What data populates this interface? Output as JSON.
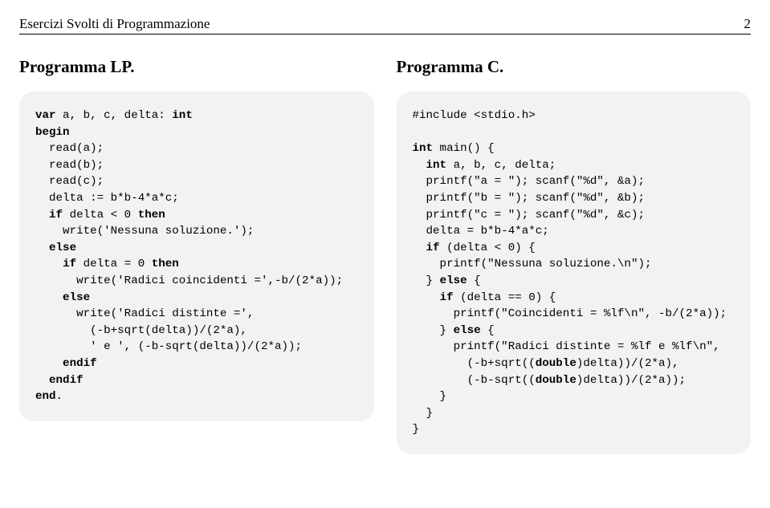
{
  "header": {
    "title": "Esercizi Svolti di Programmazione",
    "page": "2"
  },
  "left": {
    "heading": "Programma LP.",
    "l1a": "var",
    "l1b": " a, b, c, delta: ",
    "l1c": "int",
    "l2": "begin",
    "l3": "  read(a);",
    "l4": "  read(b);",
    "l5": "  read(c);",
    "l6": "  delta := b*b-4*a*c;",
    "l7a": "  ",
    "l7b": "if",
    "l7c": " delta < 0 ",
    "l7d": "then",
    "l8": "    write('Nessuna soluzione.');",
    "l9": "  else",
    "l10a": "    ",
    "l10b": "if",
    "l10c": " delta = 0 ",
    "l10d": "then",
    "l11": "      write('Radici coincidenti =',-b/(2*a));",
    "l12": "    else",
    "l13": "      write('Radici distinte =',",
    "l14": "        (-b+sqrt(delta))/(2*a),",
    "l15": "        ' e ', (-b-sqrt(delta))/(2*a));",
    "l16": "    endif",
    "l17": "  endif",
    "l18": "end"
  },
  "right": {
    "heading": "Programma C.",
    "l1": "#include <stdio.h>",
    "l2": "",
    "l3a": "int",
    "l3b": " main() {",
    "l4a": "  ",
    "l4b": "int",
    "l4c": " a, b, c, delta;",
    "l5": "  printf(\"a = \"); scanf(\"%d\", &a);",
    "l6": "  printf(\"b = \"); scanf(\"%d\", &b);",
    "l7": "  printf(\"c = \"); scanf(\"%d\", &c);",
    "l8": "  delta = b*b-4*a*c;",
    "l9a": "  ",
    "l9b": "if",
    "l9c": " (delta < 0) {",
    "l10": "    printf(\"Nessuna soluzione.\\n\");",
    "l11a": "  } ",
    "l11b": "else",
    "l11c": " {",
    "l12a": "    ",
    "l12b": "if",
    "l12c": " (delta == 0) {",
    "l13": "      printf(\"Coincidenti = %lf\\n\", -b/(2*a));",
    "l14a": "    } ",
    "l14b": "else",
    "l14c": " {",
    "l15": "      printf(\"Radici distinte = %lf e %lf\\n\",",
    "l16a": "        (-b+sqrt((",
    "l16b": "double",
    "l16c": ")delta))/(2*a),",
    "l17a": "        (-b-sqrt((",
    "l17b": "double",
    "l17c": ")delta))/(2*a));",
    "l18": "    }",
    "l19": "  }",
    "l20": "}"
  }
}
